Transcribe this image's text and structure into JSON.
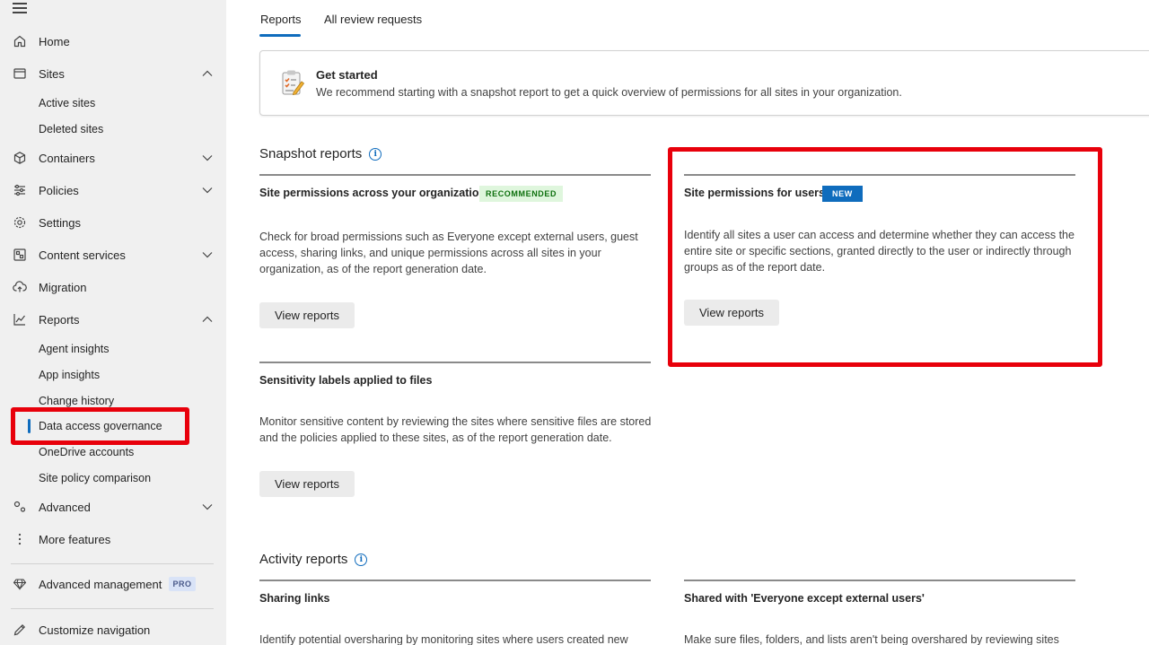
{
  "sidebar": {
    "items": [
      {
        "label": "Home",
        "icon": "home-icon"
      },
      {
        "label": "Sites",
        "icon": "sites-icon",
        "expanded": true
      },
      {
        "label": "Containers",
        "icon": "containers-icon"
      },
      {
        "label": "Policies",
        "icon": "policies-icon"
      },
      {
        "label": "Settings",
        "icon": "settings-icon"
      },
      {
        "label": "Content services",
        "icon": "content-services-icon"
      },
      {
        "label": "Migration",
        "icon": "migration-icon"
      },
      {
        "label": "Reports",
        "icon": "reports-icon",
        "expanded": true
      },
      {
        "label": "Advanced",
        "icon": "advanced-icon"
      },
      {
        "label": "More features",
        "icon": "more-icon"
      },
      {
        "label": "Advanced management",
        "icon": "diamond-icon"
      },
      {
        "label": "Customize navigation",
        "icon": "pencil-icon"
      }
    ],
    "sites_children": [
      "Active sites",
      "Deleted sites"
    ],
    "reports_children": [
      "Agent insights",
      "App insights",
      "Change history",
      "Data access governance",
      "OneDrive accounts",
      "Site policy comparison"
    ],
    "pro_badge": "PRO",
    "selected": "Data access governance"
  },
  "tabs": [
    {
      "label": "Reports",
      "active": true
    },
    {
      "label": "All review requests",
      "active": false
    }
  ],
  "get_started": {
    "title": "Get started",
    "description": "We recommend starting with a snapshot report to get a quick overview of permissions for all sites in your organization."
  },
  "snapshot": {
    "title": "Snapshot reports",
    "cards": [
      {
        "title": "Site permissions across your organization",
        "badge": "RECOMMENDED",
        "description": "Check for broad permissions such as Everyone except external users, guest access, sharing links, and unique permissions across all sites in your organization, as of the report generation date.",
        "button": "View reports"
      },
      {
        "title": "Site permissions for users",
        "badge": "NEW",
        "description": "Identify all sites a user can access and determine whether they can access the entire site or specific sections, granted directly to the user or indirectly through groups as of the report date.",
        "button": "View reports"
      },
      {
        "title": "Sensitivity labels applied to files",
        "description": "Monitor sensitive content by reviewing the sites where sensitive files are stored and the policies applied to these sites, as of the report generation date.",
        "button": "View reports"
      }
    ]
  },
  "activity": {
    "title": "Activity reports",
    "cards": [
      {
        "title": "Sharing links",
        "description": "Identify potential oversharing by monitoring sites where users created new"
      },
      {
        "title": "Shared with 'Everyone except external users'",
        "description": "Make sure files, folders, and lists aren't being overshared by reviewing sites"
      }
    ]
  },
  "colors": {
    "accent": "#0f6cbd",
    "highlight": "#e8000b",
    "sidebar_bg": "#f0f0f0"
  }
}
